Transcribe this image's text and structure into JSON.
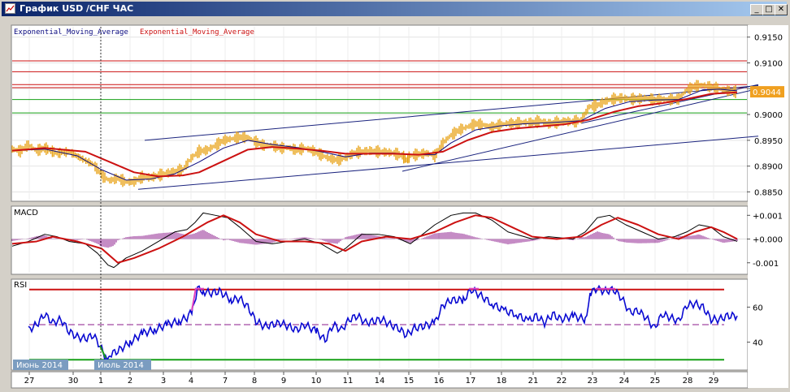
{
  "window": {
    "title": "График USD /CHF ЧАС",
    "minimize_glyph": "_",
    "maximize_glyph": "□",
    "close_glyph": "✕"
  },
  "colors": {
    "price": "#e8a317",
    "ema_fast": "#0a0a80",
    "ema_slow": "#cc1111",
    "trend": "#1a237e",
    "rsi": "#0a0ad2",
    "rsi_hot": "#e040c0",
    "rsi_cold": "#16a016",
    "hline_red": "#cc1111",
    "hline_green": "#16a016",
    "macd_hist": "#8b1a8b"
  },
  "chart_data": [
    {
      "type": "line",
      "pane": "price",
      "legend": [
        "Exponential_Moving_Average",
        "Exponential_Moving_Average"
      ],
      "yticks": [
        "0.9150",
        "0.9100",
        "0.9050",
        "0.9000",
        "0.8950",
        "0.8900",
        "0.8850"
      ],
      "ylim": [
        0.8835,
        0.917
      ],
      "last_price_label": "0.9044",
      "horizontal_levels": [
        {
          "value": 0.9104,
          "color": "red"
        },
        {
          "value": 0.9083,
          "color": "red"
        },
        {
          "value": 0.9058,
          "color": "red"
        },
        {
          "value": 0.9052,
          "color": "red"
        },
        {
          "value": 0.9029,
          "color": "green"
        },
        {
          "value": 0.9003,
          "color": "green"
        }
      ],
      "price": [
        [
          0,
          0.8933
        ],
        [
          10,
          0.8929
        ],
        [
          20,
          0.8941
        ],
        [
          30,
          0.893
        ],
        [
          40,
          0.8935
        ],
        [
          55,
          0.8925
        ],
        [
          70,
          0.8928
        ],
        [
          85,
          0.8915
        ],
        [
          100,
          0.8903
        ],
        [
          112,
          0.888
        ],
        [
          120,
          0.8872
        ],
        [
          130,
          0.8877
        ],
        [
          140,
          0.8869
        ],
        [
          150,
          0.887
        ],
        [
          160,
          0.8879
        ],
        [
          170,
          0.8878
        ],
        [
          180,
          0.8882
        ],
        [
          190,
          0.8886
        ],
        [
          200,
          0.889
        ],
        [
          210,
          0.8893
        ],
        [
          220,
          0.8915
        ],
        [
          230,
          0.8929
        ],
        [
          240,
          0.8931
        ],
        [
          250,
          0.894
        ],
        [
          260,
          0.895
        ],
        [
          270,
          0.8953
        ],
        [
          280,
          0.8956
        ],
        [
          290,
          0.8955
        ],
        [
          300,
          0.8947
        ],
        [
          310,
          0.894
        ],
        [
          320,
          0.894
        ],
        [
          330,
          0.8935
        ],
        [
          340,
          0.8936
        ],
        [
          350,
          0.8931
        ],
        [
          360,
          0.8935
        ],
        [
          370,
          0.893
        ],
        [
          380,
          0.8922
        ],
        [
          390,
          0.8915
        ],
        [
          400,
          0.8912
        ],
        [
          410,
          0.8916
        ],
        [
          420,
          0.8925
        ],
        [
          430,
          0.8928
        ],
        [
          440,
          0.893
        ],
        [
          450,
          0.8928
        ],
        [
          460,
          0.8927
        ],
        [
          470,
          0.8925
        ],
        [
          480,
          0.892
        ],
        [
          485,
          0.8912
        ],
        [
          490,
          0.892
        ],
        [
          500,
          0.8923
        ],
        [
          510,
          0.8925
        ],
        [
          520,
          0.892
        ],
        [
          530,
          0.8945
        ],
        [
          540,
          0.896
        ],
        [
          550,
          0.897
        ],
        [
          560,
          0.8976
        ],
        [
          570,
          0.8982
        ],
        [
          580,
          0.898
        ],
        [
          590,
          0.8975
        ],
        [
          600,
          0.898
        ],
        [
          610,
          0.8983
        ],
        [
          620,
          0.8983
        ],
        [
          630,
          0.8985
        ],
        [
          640,
          0.8984
        ],
        [
          650,
          0.8988
        ],
        [
          660,
          0.8982
        ],
        [
          670,
          0.8985
        ],
        [
          680,
          0.8987
        ],
        [
          690,
          0.8986
        ],
        [
          700,
          0.8989
        ],
        [
          710,
          0.9015
        ],
        [
          720,
          0.9018
        ],
        [
          730,
          0.9026
        ],
        [
          740,
          0.903
        ],
        [
          750,
          0.9032
        ],
        [
          760,
          0.903
        ],
        [
          770,
          0.903
        ],
        [
          780,
          0.9032
        ],
        [
          790,
          0.9028
        ],
        [
          800,
          0.903
        ],
        [
          810,
          0.9029
        ],
        [
          820,
          0.903
        ],
        [
          830,
          0.9048
        ],
        [
          840,
          0.9055
        ],
        [
          850,
          0.9057
        ],
        [
          860,
          0.9053
        ],
        [
          870,
          0.905
        ],
        [
          880,
          0.9046
        ],
        [
          892,
          0.9044
        ]
      ],
      "ema_fast": [
        [
          0,
          0.893
        ],
        [
          40,
          0.8933
        ],
        [
          80,
          0.892
        ],
        [
          110,
          0.8893
        ],
        [
          140,
          0.8873
        ],
        [
          170,
          0.8875
        ],
        [
          200,
          0.8885
        ],
        [
          230,
          0.8908
        ],
        [
          260,
          0.8935
        ],
        [
          290,
          0.895
        ],
        [
          320,
          0.8942
        ],
        [
          350,
          0.8936
        ],
        [
          380,
          0.8928
        ],
        [
          410,
          0.8918
        ],
        [
          440,
          0.8925
        ],
        [
          470,
          0.8925
        ],
        [
          500,
          0.8922
        ],
        [
          520,
          0.8922
        ],
        [
          540,
          0.8945
        ],
        [
          570,
          0.897
        ],
        [
          600,
          0.8978
        ],
        [
          630,
          0.8982
        ],
        [
          660,
          0.8984
        ],
        [
          700,
          0.8988
        ],
        [
          730,
          0.9012
        ],
        [
          760,
          0.9025
        ],
        [
          790,
          0.9028
        ],
        [
          820,
          0.9029
        ],
        [
          850,
          0.9048
        ],
        [
          870,
          0.9049
        ],
        [
          892,
          0.9046
        ]
      ],
      "ema_slow": [
        [
          0,
          0.893
        ],
        [
          40,
          0.8935
        ],
        [
          90,
          0.8928
        ],
        [
          120,
          0.8908
        ],
        [
          150,
          0.8888
        ],
        [
          180,
          0.888
        ],
        [
          210,
          0.8882
        ],
        [
          230,
          0.8888
        ],
        [
          260,
          0.891
        ],
        [
          290,
          0.8932
        ],
        [
          320,
          0.8937
        ],
        [
          350,
          0.8934
        ],
        [
          380,
          0.893
        ],
        [
          410,
          0.8924
        ],
        [
          440,
          0.8924
        ],
        [
          470,
          0.8924
        ],
        [
          500,
          0.8922
        ],
        [
          530,
          0.8928
        ],
        [
          560,
          0.895
        ],
        [
          590,
          0.8966
        ],
        [
          620,
          0.8973
        ],
        [
          650,
          0.8977
        ],
        [
          680,
          0.8981
        ],
        [
          710,
          0.899
        ],
        [
          740,
          0.9005
        ],
        [
          770,
          0.9016
        ],
        [
          800,
          0.9022
        ],
        [
          830,
          0.903
        ],
        [
          860,
          0.904
        ],
        [
          892,
          0.9043
        ]
      ],
      "trendlines": [
        [
          [
            155,
            0.8855
          ],
          [
            918,
            0.8958
          ]
        ],
        [
          [
            163,
            0.895
          ],
          [
            918,
            0.9056
          ]
        ],
        [
          [
            480,
            0.889
          ],
          [
            918,
            0.905
          ]
        ],
        [
          [
            700,
            0.8983
          ],
          [
            918,
            0.9058
          ]
        ]
      ]
    },
    {
      "type": "line",
      "pane": "macd",
      "label": "MACD",
      "yticks": [
        "+0.001",
        "+0.000",
        "-0.001"
      ],
      "ylim": [
        -0.00135,
        0.00125
      ],
      "macd": [
        [
          0,
          -0.0003
        ],
        [
          20,
          -0.0001
        ],
        [
          40,
          0.0002
        ],
        [
          55,
          0.0001
        ],
        [
          70,
          -0.0001
        ],
        [
          90,
          -0.0002
        ],
        [
          105,
          -0.0006
        ],
        [
          118,
          -0.0011
        ],
        [
          125,
          -0.0012
        ],
        [
          140,
          -0.0008
        ],
        [
          160,
          -0.0005
        ],
        [
          180,
          -0.0001
        ],
        [
          200,
          0.0003
        ],
        [
          215,
          0.0004
        ],
        [
          225,
          0.0007
        ],
        [
          235,
          0.0011
        ],
        [
          250,
          0.001
        ],
        [
          265,
          0.0009
        ],
        [
          280,
          0.0005
        ],
        [
          300,
          -0.0001
        ],
        [
          320,
          -0.0002
        ],
        [
          340,
          -0.0001
        ],
        [
          360,
          0.0
        ],
        [
          380,
          -0.0002
        ],
        [
          400,
          -0.0006
        ],
        [
          410,
          -0.0004
        ],
        [
          430,
          0.0002
        ],
        [
          450,
          0.0002
        ],
        [
          470,
          0.0001
        ],
        [
          490,
          -0.0002
        ],
        [
          505,
          0.0002
        ],
        [
          520,
          0.0006
        ],
        [
          540,
          0.001
        ],
        [
          555,
          0.0011
        ],
        [
          570,
          0.0011
        ],
        [
          590,
          0.0008
        ],
        [
          610,
          0.0003
        ],
        [
          640,
          0.0
        ],
        [
          660,
          0.0001
        ],
        [
          690,
          0.0
        ],
        [
          705,
          0.0003
        ],
        [
          720,
          0.0009
        ],
        [
          735,
          0.001
        ],
        [
          755,
          0.0006
        ],
        [
          775,
          0.0003
        ],
        [
          795,
          0.0
        ],
        [
          815,
          0.0001
        ],
        [
          830,
          0.0003
        ],
        [
          845,
          0.0006
        ],
        [
          860,
          0.0005
        ],
        [
          875,
          0.0001
        ],
        [
          892,
          -0.0001
        ]
      ],
      "signal": [
        [
          0,
          -0.0002
        ],
        [
          30,
          -0.0001
        ],
        [
          50,
          0.0001
        ],
        [
          80,
          -0.0001
        ],
        [
          110,
          -0.0004
        ],
        [
          130,
          -0.001
        ],
        [
          150,
          -0.0008
        ],
        [
          180,
          -0.0004
        ],
        [
          210,
          0.0001
        ],
        [
          240,
          0.0007
        ],
        [
          260,
          0.001
        ],
        [
          280,
          0.0007
        ],
        [
          300,
          0.0002
        ],
        [
          330,
          -0.0001
        ],
        [
          360,
          -0.0001
        ],
        [
          390,
          -0.0002
        ],
        [
          410,
          -0.0005
        ],
        [
          430,
          -0.0001
        ],
        [
          460,
          0.0001
        ],
        [
          490,
          0.0
        ],
        [
          520,
          0.0003
        ],
        [
          545,
          0.0007
        ],
        [
          570,
          0.001
        ],
        [
          590,
          0.0009
        ],
        [
          615,
          0.0005
        ],
        [
          640,
          0.0001
        ],
        [
          670,
          0.0
        ],
        [
          700,
          0.0001
        ],
        [
          725,
          0.0006
        ],
        [
          745,
          0.0009
        ],
        [
          770,
          0.0006
        ],
        [
          795,
          0.0002
        ],
        [
          820,
          0.0
        ],
        [
          840,
          0.0003
        ],
        [
          860,
          0.0005
        ],
        [
          875,
          0.0003
        ],
        [
          892,
          0.0
        ]
      ]
    },
    {
      "type": "line",
      "pane": "rsi",
      "label": "RSI",
      "yticks": [
        "60",
        "40"
      ],
      "ylim": [
        25,
        75
      ],
      "upper_level": 70,
      "mid_level": 50,
      "lower_level": 30,
      "rsi": [
        [
          20,
          47
        ],
        [
          30,
          50
        ],
        [
          40,
          56
        ],
        [
          50,
          51
        ],
        [
          60,
          53
        ],
        [
          70,
          46
        ],
        [
          80,
          43
        ],
        [
          90,
          42
        ],
        [
          100,
          44
        ],
        [
          108,
          38
        ],
        [
          115,
          31
        ],
        [
          120,
          33
        ],
        [
          130,
          35
        ],
        [
          145,
          40
        ],
        [
          160,
          45
        ],
        [
          175,
          47
        ],
        [
          190,
          50
        ],
        [
          205,
          52
        ],
        [
          215,
          54
        ],
        [
          222,
          58
        ],
        [
          228,
          71
        ],
        [
          235,
          69
        ],
        [
          245,
          68
        ],
        [
          255,
          69
        ],
        [
          270,
          64
        ],
        [
          280,
          65
        ],
        [
          290,
          60
        ],
        [
          300,
          52
        ],
        [
          310,
          49
        ],
        [
          320,
          50
        ],
        [
          330,
          51
        ],
        [
          340,
          49
        ],
        [
          350,
          47
        ],
        [
          360,
          50
        ],
        [
          375,
          46
        ],
        [
          385,
          41
        ],
        [
          395,
          50
        ],
        [
          405,
          47
        ],
        [
          415,
          53
        ],
        [
          425,
          55
        ],
        [
          435,
          51
        ],
        [
          445,
          52
        ],
        [
          455,
          53
        ],
        [
          465,
          50
        ],
        [
          475,
          48
        ],
        [
          485,
          44
        ],
        [
          495,
          48
        ],
        [
          505,
          49
        ],
        [
          520,
          51
        ],
        [
          530,
          61
        ],
        [
          540,
          64
        ],
        [
          555,
          64
        ],
        [
          565,
          70
        ],
        [
          575,
          67
        ],
        [
          590,
          62
        ],
        [
          605,
          58
        ],
        [
          620,
          56
        ],
        [
          635,
          52
        ],
        [
          645,
          55
        ],
        [
          655,
          51
        ],
        [
          665,
          56
        ],
        [
          675,
          53
        ],
        [
          690,
          55
        ],
        [
          705,
          53
        ],
        [
          712,
          68
        ],
        [
          720,
          71
        ],
        [
          728,
          69
        ],
        [
          740,
          70
        ],
        [
          750,
          65
        ],
        [
          760,
          57
        ],
        [
          770,
          58
        ],
        [
          780,
          54
        ],
        [
          790,
          48
        ],
        [
          800,
          56
        ],
        [
          810,
          54
        ],
        [
          820,
          52
        ],
        [
          830,
          61
        ],
        [
          840,
          62
        ],
        [
          850,
          60
        ],
        [
          860,
          53
        ],
        [
          870,
          53
        ],
        [
          880,
          55
        ],
        [
          892,
          55
        ]
      ]
    }
  ],
  "x_axis": {
    "month_labels": [
      "Июнь 2014",
      "Июль 2014"
    ],
    "day_labels": [
      "27",
      "30",
      "1",
      "2",
      "3",
      "4",
      "7",
      "8",
      "9",
      "10",
      "11",
      "14",
      "15",
      "16",
      "17",
      "18",
      "21",
      "22",
      "23",
      "24",
      "25",
      "28",
      "29"
    ]
  }
}
